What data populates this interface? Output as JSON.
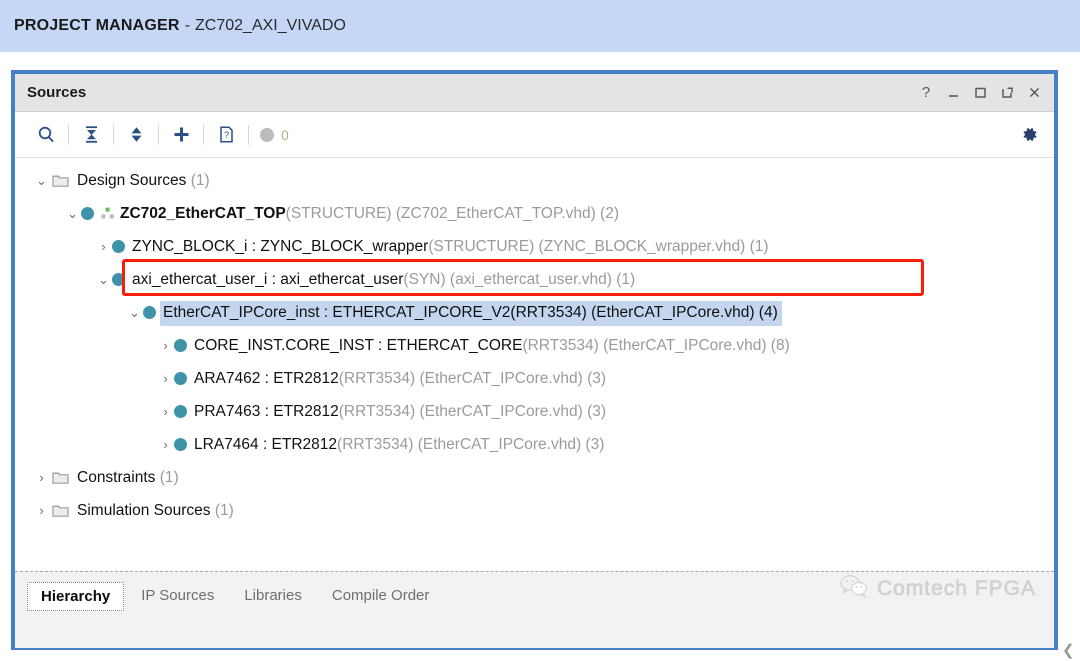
{
  "banner": {
    "title": "PROJECT MANAGER",
    "separator": "-",
    "project": "ZC702_AXI_VIVADO"
  },
  "panel": {
    "title": "Sources",
    "window_controls": [
      {
        "name": "help",
        "glyph": "?"
      },
      {
        "name": "minimize",
        "glyph": "–"
      },
      {
        "name": "maximize",
        "glyph": "□"
      },
      {
        "name": "float",
        "glyph": "↗"
      },
      {
        "name": "close",
        "glyph": "✕"
      }
    ],
    "toolbar": {
      "icons": [
        "search-icon",
        "collapse-all-icon",
        "expand-all-icon",
        "add-sources-icon",
        "report-icon"
      ],
      "badge_count": "0",
      "settings_icon": "gear-icon"
    }
  },
  "tree": {
    "rows": [
      {
        "indent": 0,
        "twisty": "⌄",
        "icon": "folder",
        "main": "Design Sources",
        "dim_suffix": " (1)",
        "bold": false,
        "selected": false
      },
      {
        "indent": 1,
        "twisty": "⌄",
        "icon": "circle-hier",
        "main": "ZC702_EtherCAT_TOP",
        "dim": "(STRUCTURE) (ZC702_EtherCAT_TOP.vhd) (2)",
        "bold": true,
        "selected": false
      },
      {
        "indent": 2,
        "twisty": "›",
        "icon": "circle",
        "main": "ZYNC_BLOCK_i : ZYNC_BLOCK_wrapper",
        "dim": "(STRUCTURE) (ZYNC_BLOCK_wrapper.vhd) (1)",
        "bold": false,
        "selected": false
      },
      {
        "indent": 2,
        "twisty": "⌄",
        "icon": "circle",
        "main": "axi_ethercat_user_i : axi_ethercat_user",
        "dim": "(SYN) (axi_ethercat_user.vhd) (1)",
        "bold": false,
        "selected": false,
        "highlight_box": true
      },
      {
        "indent": 3,
        "twisty": "⌄",
        "icon": "circle",
        "main": "EtherCAT_IPCore_inst : ETHERCAT_IPCORE_V2(RRT3534) (EtherCAT_IPCore.vhd) (4)",
        "dim": "",
        "bold": false,
        "selected": true
      },
      {
        "indent": 4,
        "twisty": "›",
        "icon": "circle",
        "main": "CORE_INST.CORE_INST : ETHERCAT_CORE",
        "dim": "(RRT3534) (EtherCAT_IPCore.vhd) (8)",
        "bold": false,
        "selected": false
      },
      {
        "indent": 4,
        "twisty": "›",
        "icon": "circle",
        "main": "ARA7462 : ETR2812",
        "dim": "(RRT3534) (EtherCAT_IPCore.vhd) (3)",
        "bold": false,
        "selected": false
      },
      {
        "indent": 4,
        "twisty": "›",
        "icon": "circle",
        "main": "PRA7463 : ETR2812",
        "dim": "(RRT3534) (EtherCAT_IPCore.vhd) (3)",
        "bold": false,
        "selected": false
      },
      {
        "indent": 4,
        "twisty": "›",
        "icon": "circle",
        "main": "LRA7464 : ETR2812",
        "dim": "(RRT3534) (EtherCAT_IPCore.vhd) (3)",
        "bold": false,
        "selected": false
      },
      {
        "indent": 0,
        "twisty": "›",
        "icon": "folder",
        "main": "Constraints",
        "dim_suffix": " (1)",
        "bold": false,
        "selected": false
      },
      {
        "indent": 0,
        "twisty": "›",
        "icon": "folder",
        "main": "Simulation Sources",
        "dim_suffix": " (1)",
        "bold": false,
        "selected": false
      }
    ]
  },
  "tabs": [
    {
      "label": "Hierarchy",
      "active": true
    },
    {
      "label": "IP Sources",
      "active": false
    },
    {
      "label": "Libraries",
      "active": false
    },
    {
      "label": "Compile Order",
      "active": false
    }
  ],
  "watermark": {
    "text": "Comtech FPGA",
    "icon": "wechat-icon"
  },
  "colors": {
    "banner_bg": "#c6d7f6",
    "panel_border": "#4880c8",
    "callout_red": "#f71e0c",
    "selection_blue": "#c3d5ef",
    "node_teal": "#3f93a8",
    "toolbar_icon": "#2b4f86"
  }
}
